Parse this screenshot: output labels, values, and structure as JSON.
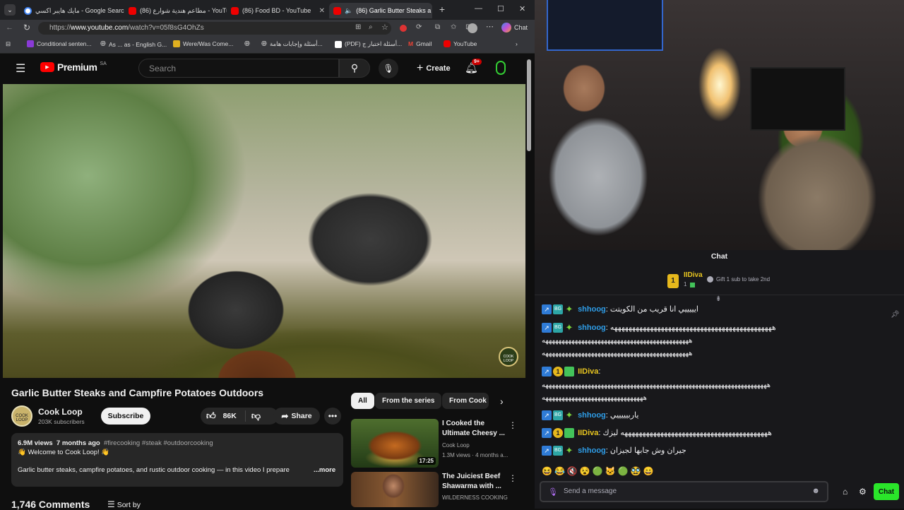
{
  "browser": {
    "tabs": [
      {
        "label": "مايك هايبر اكسي - Google Search",
        "icon": "google-icon"
      },
      {
        "label": "(86) مطاعم هندية شوارع - YouTube",
        "icon": "youtube-icon"
      },
      {
        "label": "(86) Food BD - YouTube",
        "icon": "youtube-icon"
      },
      {
        "label": "(86) Garlic Butter Steaks a",
        "icon": "youtube-icon",
        "active": true
      }
    ],
    "url_prefix": "https://",
    "url_host": "www.youtube.com",
    "url_path": "/watch?v=05f8sG4OhZs",
    "chat_label": "Chat",
    "bookmarks": [
      "Conditional senten...",
      "As ... as - English G...",
      "Were/Was Come...",
      "أسئلة وإجابات هامة...",
      "(PDF) أسئلة اختبار ج...",
      "Gmail",
      "YouTube"
    ]
  },
  "youtube": {
    "logo": "Premium",
    "region": "SA",
    "search_placeholder": "Search",
    "create_label": "Create",
    "notif_count": "9+",
    "video": {
      "title": "Garlic Butter Steaks and Campfire Potatoes Outdoors",
      "badge_text": "COOK LOOP"
    },
    "channel": {
      "name": "Cook Loop",
      "subscribers": "203K subscribers",
      "avatar_text": "COOK LOOP"
    },
    "subscribe_label": "Subscribe",
    "likes": "86K",
    "share_label": "Share",
    "more_symbol": "•••",
    "description": {
      "views": "6.9M views",
      "age": "7 months ago",
      "tags": "#firecooking #steak #outdoorcooking",
      "welcome": "👋 Welcome to Cook Loop! 👋",
      "text": "Garlic butter steaks, campfire potatoes, and rustic outdoor cooking — in this video I prepare",
      "more": "...more"
    },
    "comments": "1,746 Comments",
    "sort_by": "Sort by",
    "chips": [
      "All",
      "From the series",
      "From Cook L"
    ],
    "recommendations": [
      {
        "title": "I Cooked the Ultimate Cheesy ...",
        "channel": "Cook Loop",
        "meta": "1.3M views · 4 months a...",
        "duration": "17:25"
      },
      {
        "title": "The Juiciest Beef Shawarma with ...",
        "channel": "WILDERNESS COOKING",
        "meta": "",
        "duration": ""
      }
    ]
  },
  "chat": {
    "header": "Chat",
    "pinned_user": "IIDiva",
    "pinned_count": "1",
    "pinned_text": "Gift 1 sub to take 2nd",
    "messages": [
      {
        "user": "shhoog",
        "text": "ايييييي انا قريب من الكويتت",
        "gold": false
      },
      {
        "user": "shhoog",
        "text": "هههههههههههههههههههههههههههههههههههههههههههههه",
        "gold": false,
        "cont": [
          "هههههههههههههههههههههههههههههههههههههههههههههه",
          "هههههههههههههههههههههههههههههههههههههههههههههه"
        ]
      },
      {
        "user": "IIDiva",
        "text": "",
        "gold": true,
        "cont": [
          "هههههههههههههههههههههههههههههههههههههههههههههههههههههههههههههههههههههه",
          "هههههههههههههههههههههههههههههههه"
        ]
      },
      {
        "user": "shhoog",
        "text": "ياربيييييي",
        "gold": false
      },
      {
        "user": "IIDiva",
        "text": "هههههههههههههههههههههههههههههههههههههههههه ليزك",
        "gold": true
      },
      {
        "user": "shhoog",
        "text": "جيران وش جابها لجيزان",
        "gold": false
      }
    ],
    "input_placeholder": "Send a message",
    "chat_button": "Chat"
  }
}
